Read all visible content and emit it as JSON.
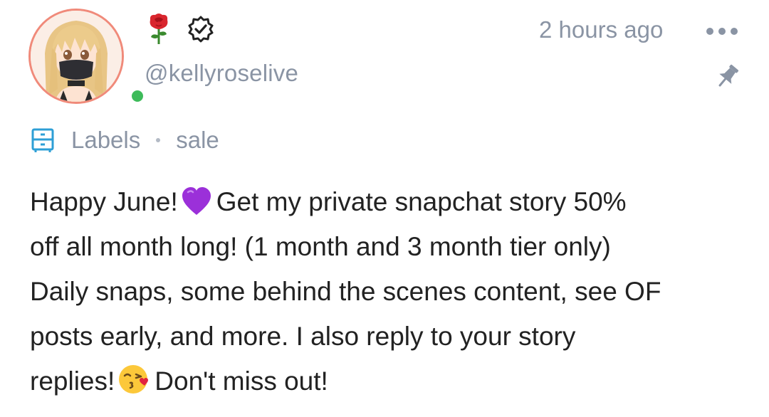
{
  "post": {
    "author": {
      "handle": "@kellyroselive",
      "avatar_icon": "avatar-image",
      "badges": [
        "rose-icon",
        "verified-badge-icon"
      ],
      "online": true,
      "online_color": "#3dbb5a",
      "avatar_ring_color": "#f08a7a"
    },
    "timestamp": "2 hours ago",
    "menu_icon": "more-dots-icon",
    "pin_icon": "pin-icon",
    "labels": {
      "icon": "drawer-icon",
      "title": "Labels",
      "tags": [
        "sale"
      ]
    },
    "body": {
      "line1_a": "Happy June!",
      "emoji1": "purple-heart",
      "line1_b": "Get my private snapchat story 50%",
      "line2": "off all month long! (1 month and 3 month tier only)",
      "line3": "Daily snaps, some behind the scenes content, see OF",
      "line4": "posts early, and more. I also reply to your story",
      "line5_a": "replies!",
      "emoji2": "face-blowing-kiss",
      "line5_b": "Don't miss out!"
    }
  },
  "colors": {
    "muted_text": "#8a94a4",
    "body_text": "#222222",
    "accent_blue": "#2e9fd6"
  }
}
